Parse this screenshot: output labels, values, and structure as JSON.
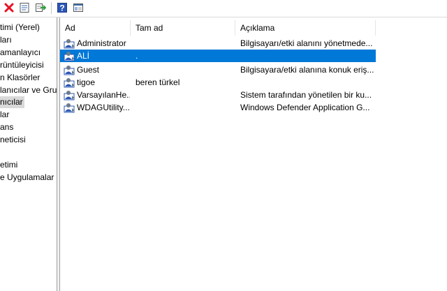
{
  "toolbar": {
    "buttons": [
      {
        "name": "delete-icon",
        "glyph": "✖",
        "color": "#e81123"
      },
      {
        "name": "properties-icon"
      },
      {
        "name": "export-list-icon"
      },
      {
        "name": "help-icon",
        "glyph": "?"
      },
      {
        "name": "show-hide-action-pane-icon"
      }
    ]
  },
  "tree": {
    "items": [
      {
        "label": "timi (Yerel)"
      },
      {
        "label": "ları"
      },
      {
        "label": "amanlayıcı"
      },
      {
        "label": "rüntüleyicisi"
      },
      {
        "label": "n Klasörler"
      },
      {
        "label": "lanıcılar ve Gru"
      },
      {
        "label": "nıcılar",
        "selected": true
      },
      {
        "label": "lar"
      },
      {
        "label": "ans"
      },
      {
        "label": "neticisi"
      },
      {
        "label": ""
      },
      {
        "label": "etimi"
      },
      {
        "label": "e Uygulamalar"
      }
    ]
  },
  "table": {
    "columns": [
      "Ad",
      "Tam ad",
      "Açıklama"
    ],
    "rows": [
      {
        "name": "Administrator",
        "fullname": "",
        "description": "Bilgisayarı/etki alanını yönetmede..."
      },
      {
        "name": "ALİ",
        "fullname": ".",
        "description": "",
        "selected": true
      },
      {
        "name": "Guest",
        "fullname": "",
        "description": "Bilgisayara/etki alanına konuk eriş..."
      },
      {
        "name": "tigoe",
        "fullname": "beren türkel",
        "description": ""
      },
      {
        "name": "VarsayılanHe...",
        "fullname": "",
        "description": "Sistem tarafından yönetilen bir ku..."
      },
      {
        "name": "WDAGUtility...",
        "fullname": "",
        "description": "Windows Defender Application G..."
      }
    ]
  },
  "colors": {
    "selection": "#0078d7",
    "treeSelection": "#d9d9d9"
  }
}
